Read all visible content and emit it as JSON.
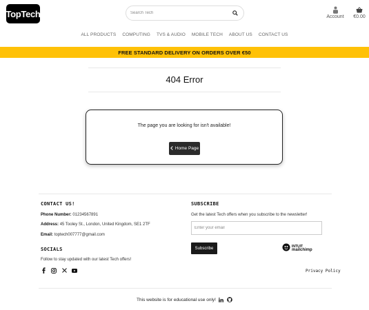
{
  "header": {
    "logo": "TopTech",
    "search_placeholder": "Search Tech",
    "account_label": "Account",
    "cart_total": "€0.00"
  },
  "nav": {
    "items": [
      "ALL PRODUCTS",
      "COMPUTING",
      "TVS & AUDIO",
      "MOBILE TECH",
      "ABOUT US",
      "CONTACT US"
    ]
  },
  "banner": {
    "text": "FREE STANDARD DELIVERY ON ORDERS OVER €50"
  },
  "main": {
    "title": "404 Error",
    "message": "The page you are looking for isn't available!",
    "home_button": "Home Page"
  },
  "footer": {
    "contact": {
      "heading": "CONTACT US!",
      "phone_label": "Phone Number:",
      "phone": "01234567891",
      "address_label": "Address:",
      "address": "45 Tooley St., London, United Kingdom, SE1 2TF",
      "email_label": "Email:",
      "email": "toptech007777@gmail.com"
    },
    "socials": {
      "heading": "SOCIALS",
      "text": "Follow to stay updated with our latest Tech offers!",
      "icons": [
        "facebook-icon",
        "instagram-icon",
        "x-icon",
        "youtube-icon"
      ]
    },
    "subscribe": {
      "heading": "SUBSCRIBE",
      "text": "Get the latest Tech offers when you subscribe to the newsletter!",
      "email_placeholder": "Enter your email",
      "button": "Subscribe",
      "mailchimp_line1": "INTUIT",
      "mailchimp_line2": "mailchimp"
    },
    "privacy": "Privacy Policy",
    "edu_note": "This website is for educational use only!"
  },
  "colors": {
    "banner": "#ffc107",
    "dark": "#1a1a1a"
  }
}
